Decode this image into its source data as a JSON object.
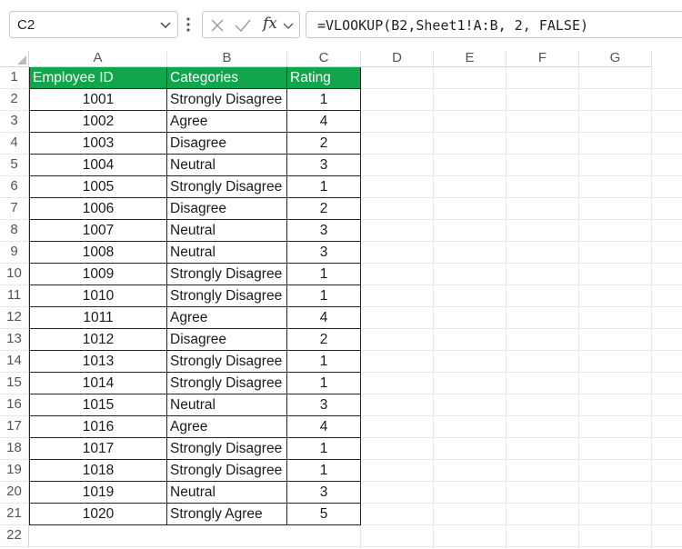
{
  "name_box": "C2",
  "formula": "=VLOOKUP(B2,Sheet1!A:B, 2, FALSE)",
  "fx_label": "fx",
  "columns": [
    "A",
    "B",
    "C",
    "D",
    "E",
    "F",
    "G"
  ],
  "rows": [
    "1",
    "2",
    "3",
    "4",
    "5",
    "6",
    "7",
    "8",
    "9",
    "10",
    "11",
    "12",
    "13",
    "14",
    "15",
    "16",
    "17",
    "18",
    "19",
    "20",
    "21",
    "22"
  ],
  "table": {
    "header": [
      "Employee ID",
      "Categories",
      "Rating"
    ],
    "data": [
      [
        "1001",
        "Strongly Disagree",
        "1"
      ],
      [
        "1002",
        "Agree",
        "4"
      ],
      [
        "1003",
        "Disagree",
        "2"
      ],
      [
        "1004",
        "Neutral",
        "3"
      ],
      [
        "1005",
        "Strongly Disagree",
        "1"
      ],
      [
        "1006",
        "Disagree",
        "2"
      ],
      [
        "1007",
        "Neutral",
        "3"
      ],
      [
        "1008",
        "Neutral",
        "3"
      ],
      [
        "1009",
        "Strongly Disagree",
        "1"
      ],
      [
        "1010",
        "Strongly Disagree",
        "1"
      ],
      [
        "1011",
        "Agree",
        "4"
      ],
      [
        "1012",
        "Disagree",
        "2"
      ],
      [
        "1013",
        "Strongly Disagree",
        "1"
      ],
      [
        "1014",
        "Strongly Disagree",
        "1"
      ],
      [
        "1015",
        "Neutral",
        "3"
      ],
      [
        "1016",
        "Agree",
        "4"
      ],
      [
        "1017",
        "Strongly Disagree",
        "1"
      ],
      [
        "1018",
        "Strongly Disagree",
        "1"
      ],
      [
        "1019",
        "Neutral",
        "3"
      ],
      [
        "1020",
        "Strongly Agree",
        "5"
      ]
    ]
  },
  "colors": {
    "header_fill": "#11a64b",
    "header_text": "#ffffff"
  },
  "icons": {
    "cancel": "close-icon",
    "enter": "check-icon",
    "function": "fx-icon"
  }
}
